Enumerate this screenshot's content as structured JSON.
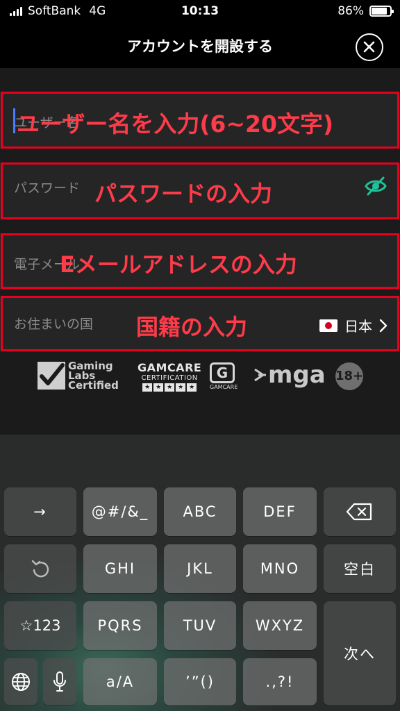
{
  "status_bar": {
    "carrier": "SoftBank",
    "network": "4G",
    "time": "10:13",
    "battery": "86%",
    "battery_level": 0.86
  },
  "header": {
    "title": "アカウントを開設する",
    "close_icon": "close-circle-icon"
  },
  "form": {
    "username": {
      "placeholder": "ユーザー名",
      "annotation": "ユーザー名を入力(6~20文字)"
    },
    "password": {
      "placeholder": "パスワード",
      "annotation": "パスワードの入力",
      "icon": "eye-off-icon"
    },
    "email": {
      "placeholder": "電子メール",
      "annotation": "Eメールアドレスの入力"
    },
    "country": {
      "label": "お住まいの国",
      "annotation": "国籍の入力",
      "value": "日本",
      "flag_icon": "japan-flag-icon"
    },
    "annotation_color": "#e8001f"
  },
  "logos": {
    "gli": {
      "line1": "Gaming",
      "line2": "Labs",
      "line3": "Certified"
    },
    "gamcare_cert": {
      "line1": "GAMCARE",
      "line2": "CERTIFICATION",
      "stars": "★★★★★"
    },
    "gamcare": {
      "letter": "G",
      "label": "GAMCARE"
    },
    "mga": "mga",
    "age": "18+"
  },
  "keyboard": {
    "row1": [
      "→",
      "@#/&_",
      "ABC",
      "DEF"
    ],
    "row2": [
      "GHI",
      "JKL",
      "MNO",
      "空白"
    ],
    "row3": [
      "☆123",
      "PQRS",
      "TUV",
      "WXYZ"
    ],
    "row4": [
      "a/A",
      "’”()",
      ".,?!"
    ],
    "next": "次へ",
    "icons": [
      "backspace-icon",
      "undo-icon",
      "globe-icon",
      "microphone-icon"
    ]
  }
}
